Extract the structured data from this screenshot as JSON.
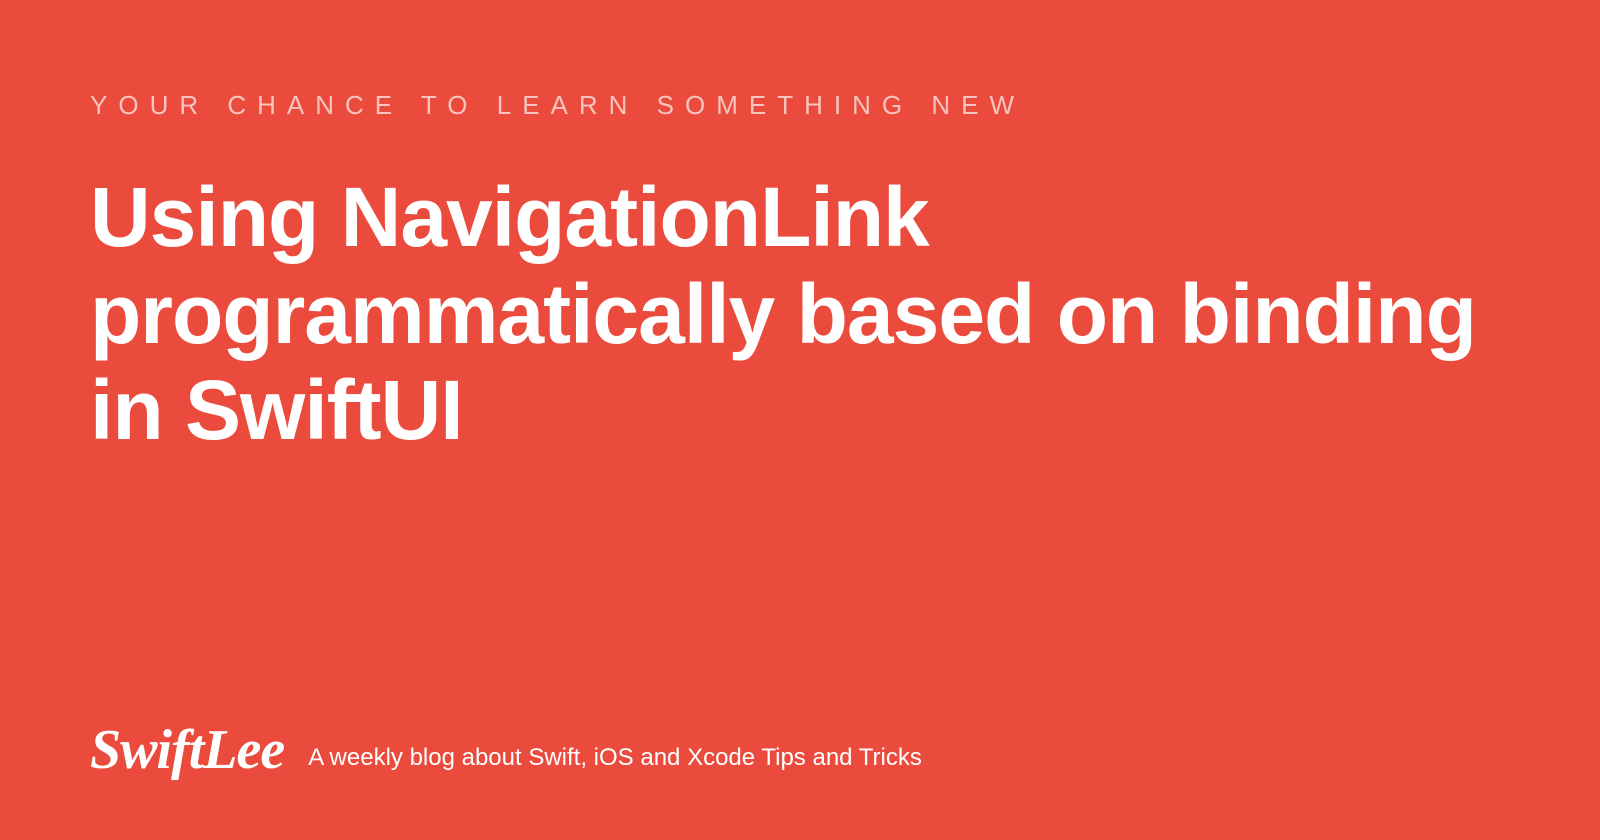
{
  "eyebrow": "YOUR CHANCE TO LEARN SOMETHING NEW",
  "title": "Using NavigationLink programmatically based on binding in SwiftUI",
  "logo": "SwiftLee",
  "tagline": "A weekly blog about Swift, iOS and Xcode Tips and Tricks",
  "colors": {
    "background": "#ea4b3c",
    "text": "#ffffff",
    "eyebrow": "#f8c4bd"
  }
}
